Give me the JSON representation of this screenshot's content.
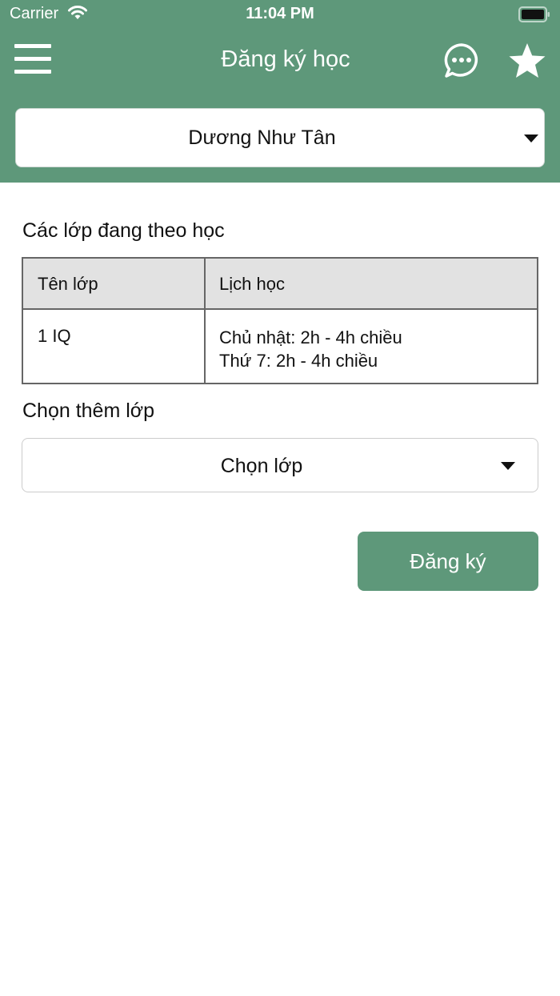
{
  "status_bar": {
    "carrier": "Carrier",
    "time": "11:04 PM",
    "icons": [
      "wifi-icon",
      "battery-icon"
    ]
  },
  "nav": {
    "title": "Đăng ký học",
    "icons": [
      "menu-icon",
      "chat-bubble-icon",
      "star-icon"
    ]
  },
  "student_select": {
    "value": "Dương Như Tân"
  },
  "current_classes": {
    "title": "Các lớp đang theo học",
    "columns": [
      "Tên lớp",
      "Lịch học"
    ],
    "rows": [
      {
        "name": "1 IQ",
        "schedule": [
          "Chủ nhật: 2h - 4h chiều",
          "Thứ 7: 2h - 4h chiều"
        ]
      }
    ]
  },
  "add_class": {
    "title": "Chọn thêm lớp",
    "select_value": "Chọn lớp"
  },
  "register_button": {
    "label": "Đăng ký"
  },
  "colors": {
    "primary": "#5e987a",
    "table_header_bg": "#e2e2e2",
    "table_border": "#666666"
  }
}
